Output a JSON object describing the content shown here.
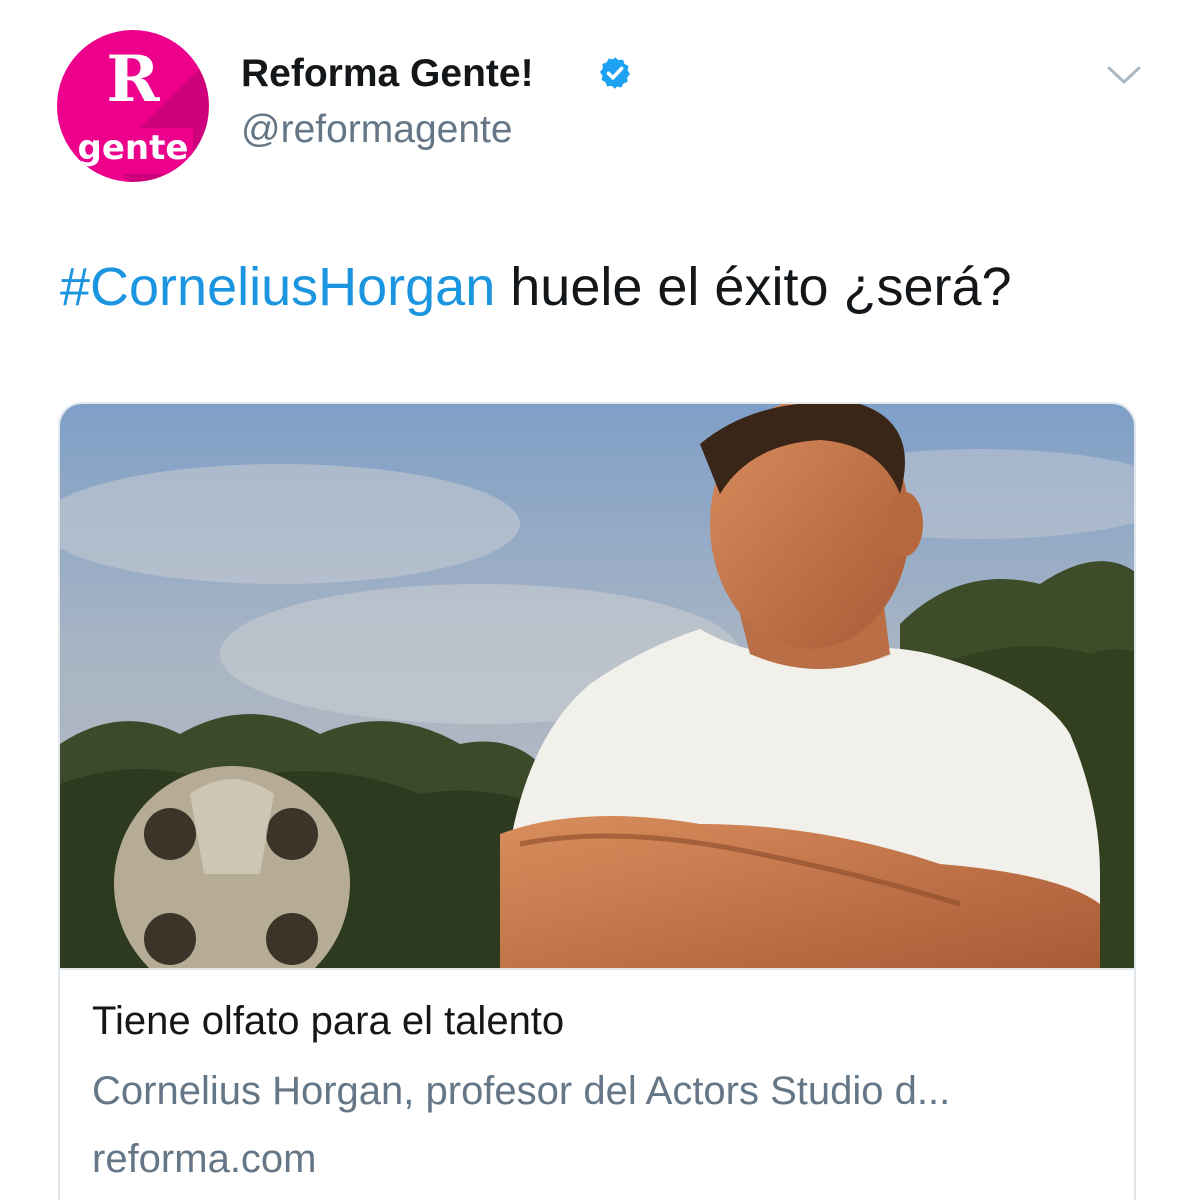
{
  "author": {
    "avatar_letter": "R",
    "avatar_word": "gente",
    "display_name": "Reforma Gente!",
    "handle": "@reformagente",
    "verified_icon": "verified-badge-icon",
    "menu_icon": "chevron-down-icon"
  },
  "tweet": {
    "hashtag": "#CorneliusHorgan",
    "text": " huele el éxito ¿será?"
  },
  "card": {
    "image_icon": "photo",
    "title": "Tiene olfato para el talento",
    "description": "Cornelius Horgan, profesor del Actors Studio d...",
    "domain": "reforma.com"
  },
  "colors": {
    "brand_pink": "#ec008c",
    "link_blue": "#1b95e0",
    "verified_blue": "#1da1f2",
    "muted_gray": "#657786",
    "text_dark": "#14171a",
    "border": "#e1e8ed"
  }
}
